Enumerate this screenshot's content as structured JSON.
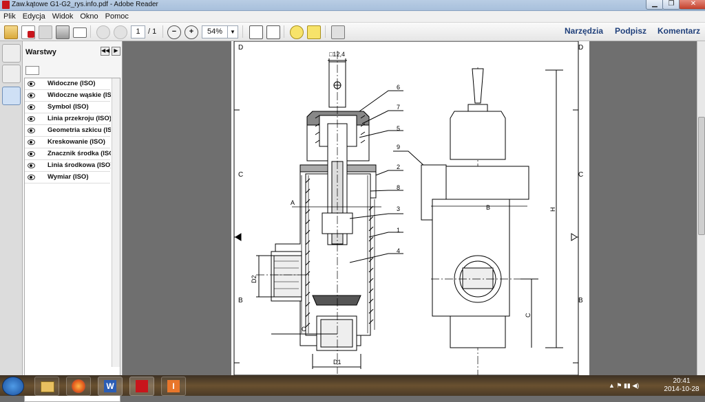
{
  "window": {
    "title": "Zaw.kątowe G1-G2_rys.info.pdf - Adobe Reader",
    "minimize": "▁",
    "restore": "❐",
    "close": "✕"
  },
  "menu": [
    "Plik",
    "Edycja",
    "Widok",
    "Okno",
    "Pomoc"
  ],
  "toolbar": {
    "page_current": "1",
    "page_total": "/ 1",
    "zoom": "54%",
    "links": [
      "Narzędzia",
      "Podpisz",
      "Komentarz"
    ]
  },
  "panel": {
    "title": "Warstwy",
    "layers": [
      "Widoczne (ISO)",
      "Widoczne wąskie (ISO",
      "Symbol (ISO)",
      "Linia przekroju (ISO)",
      "Geometria szkicu (ISO",
      "Kreskowanie (ISO)",
      "Znacznik środka (ISO)",
      "Linia środkowa (ISO)",
      "Wymiar (ISO)"
    ]
  },
  "drawing": {
    "zone_letters": [
      "D",
      "C",
      "B"
    ],
    "square_dim": "□12,4",
    "callouts": [
      "6",
      "7",
      "5",
      "9",
      "2",
      "8",
      "3",
      "1",
      "4"
    ],
    "section_labels": [
      "A",
      "B"
    ],
    "dims": [
      "D2",
      "C",
      "D1",
      "H",
      "C"
    ]
  },
  "taskbar": {
    "apps": [
      "explorer-icon",
      "firefox-icon",
      "word-icon",
      "acrobat-icon",
      "inventor-icon"
    ],
    "time": "20:41",
    "date": "2014-10-28"
  }
}
